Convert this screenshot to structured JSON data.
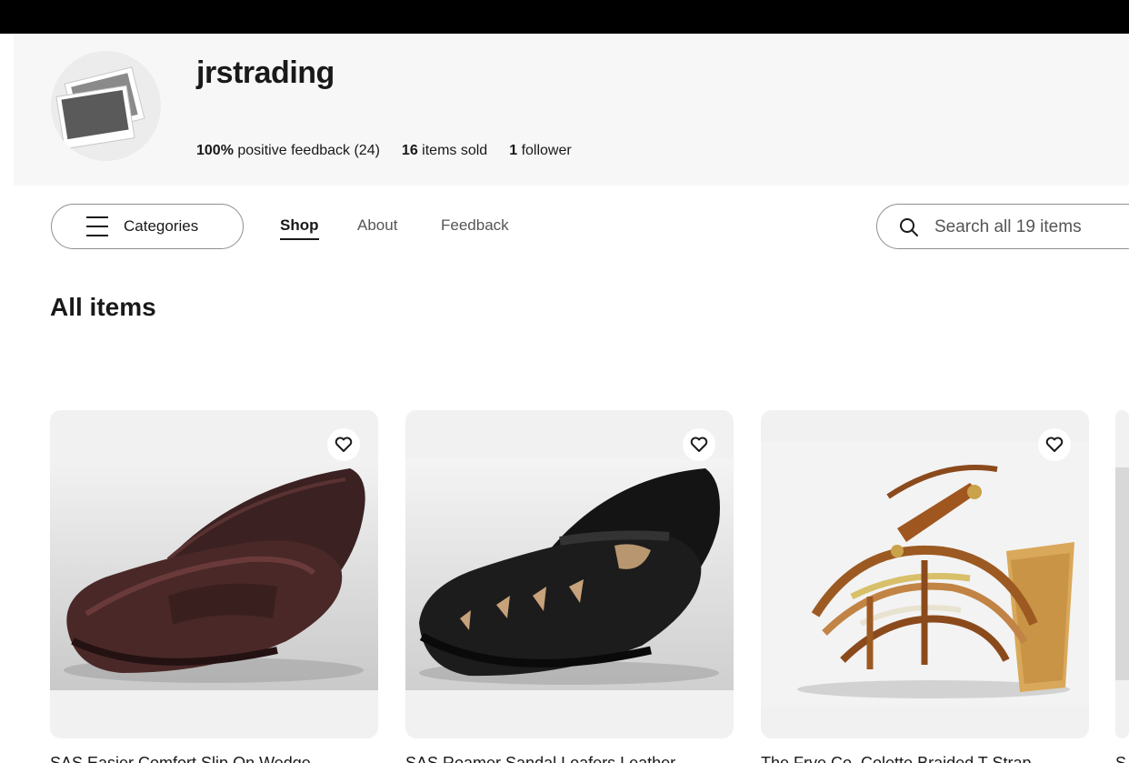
{
  "store": {
    "name": "jrstrading",
    "stats": {
      "feedback_pct": "100%",
      "feedback_label": "positive feedback",
      "feedback_count": "(24)",
      "sold_count": "16",
      "sold_label": "items sold",
      "followers_count": "1",
      "followers_label": "follower"
    }
  },
  "nav": {
    "categories_label": "Categories",
    "tabs": [
      {
        "label": "Shop",
        "active": true
      },
      {
        "label": "About",
        "active": false
      },
      {
        "label": "Feedback",
        "active": false
      }
    ],
    "search_placeholder": "Search all 19 items"
  },
  "main": {
    "section_title": "All items",
    "items": [
      {
        "title": "SAS Easier Comfort Slip On Wedge",
        "icon": "heart-icon"
      },
      {
        "title": "SAS Roamer Sandal Loafers Leather",
        "icon": "heart-icon"
      },
      {
        "title": "The Frye Co. Colette Braided T Strap",
        "icon": "heart-icon"
      },
      {
        "title": "S",
        "icon": "heart-icon"
      }
    ]
  },
  "colors": {
    "topbar": "#000000",
    "header_bg": "#f7f7f7",
    "text": "#191919",
    "muted": "#555555",
    "card_bg": "#f1f1f1"
  }
}
